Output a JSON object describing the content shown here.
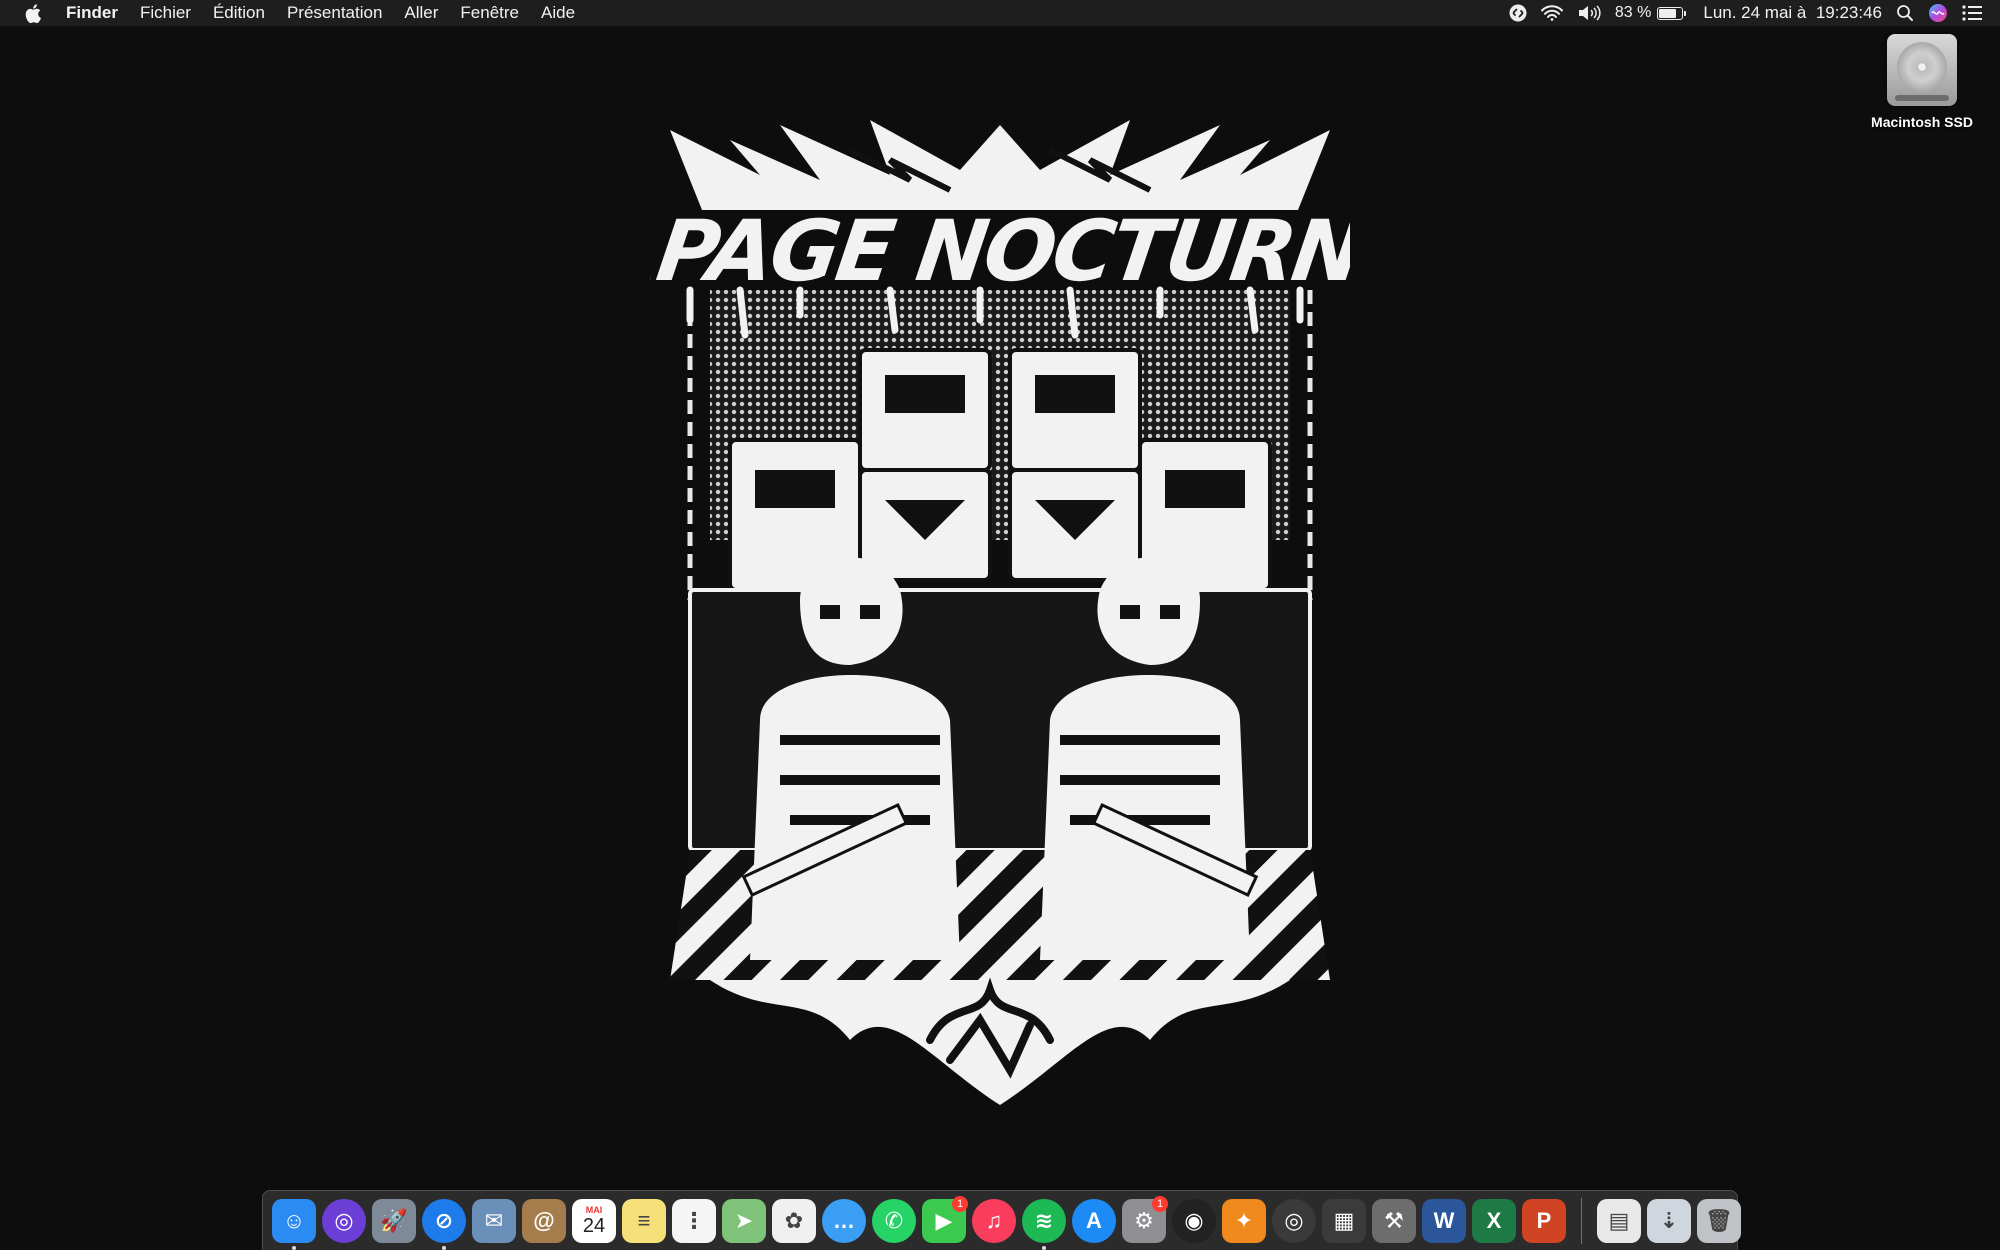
{
  "menubar": {
    "app_name": "Finder",
    "menus": [
      "Fichier",
      "Édition",
      "Présentation",
      "Aller",
      "Fenêtre",
      "Aide"
    ],
    "status": {
      "icons": [
        "shazam-icon",
        "wifi-icon",
        "volume-icon"
      ],
      "battery_percent_label": "83 %",
      "battery_level": 0.83,
      "clock": "Lun. 24 mai à  19:23:46",
      "right_icons": [
        "spotlight-icon",
        "siri-icon",
        "notification-center-icon"
      ]
    }
  },
  "desktop": {
    "icons": [
      {
        "label": "Macintosh SSD",
        "icon": "hard-drive-icon"
      }
    ]
  },
  "wallpaper": {
    "title": "TAPAGE NOCTURNE",
    "signature": "artist tag"
  },
  "dock": {
    "apps": [
      {
        "name": "Finder",
        "icon": "finder-icon",
        "color": "#2a8bf2",
        "glyph": "☺",
        "running": true
      },
      {
        "name": "Siri",
        "icon": "siri-icon",
        "color": "#6b3fd6",
        "glyph": "◎"
      },
      {
        "name": "Launchpad",
        "icon": "launchpad-icon",
        "color": "#7f8a99",
        "glyph": "🚀"
      },
      {
        "name": "Safari",
        "icon": "safari-icon",
        "color": "#1e7bea",
        "glyph": "⊘",
        "running": true
      },
      {
        "name": "Aperçu",
        "icon": "preview-icon",
        "color": "#6a8fb8",
        "glyph": "✉"
      },
      {
        "name": "Contacts",
        "icon": "contacts-icon",
        "color": "#a57c4b",
        "glyph": "@"
      },
      {
        "name": "Calendrier",
        "icon": "calendar-icon",
        "color": "#ffffff",
        "glyph": "24",
        "month": "MAI"
      },
      {
        "name": "Notes",
        "icon": "notes-icon",
        "color": "#f6e07a",
        "glyph": "≡"
      },
      {
        "name": "Rappels",
        "icon": "reminders-icon",
        "color": "#f5f5f5",
        "glyph": "⋮"
      },
      {
        "name": "Plans",
        "icon": "maps-icon",
        "color": "#7fc27a",
        "glyph": "➤"
      },
      {
        "name": "Photos",
        "icon": "photos-icon",
        "color": "#f0f0f0",
        "glyph": "✿"
      },
      {
        "name": "Messages",
        "icon": "messages-icon",
        "color": "#3a9ef5",
        "glyph": "…"
      },
      {
        "name": "WhatsApp",
        "icon": "whatsapp-icon",
        "color": "#25d366",
        "glyph": "✆"
      },
      {
        "name": "FaceTime",
        "icon": "facetime-icon",
        "color": "#3cc94f",
        "glyph": "▶",
        "badge": "1"
      },
      {
        "name": "Musique",
        "icon": "music-icon",
        "color": "#fa3d5d",
        "glyph": "♫"
      },
      {
        "name": "Spotify",
        "icon": "spotify-icon",
        "color": "#1db954",
        "glyph": "≋",
        "running": true
      },
      {
        "name": "App Store",
        "icon": "app-store-icon",
        "color": "#1c8bf5",
        "glyph": "A"
      },
      {
        "name": "Préférences Système",
        "icon": "system-preferences-icon",
        "color": "#8e8e93",
        "glyph": "⚙",
        "badge": "1"
      },
      {
        "name": "Scrobbler",
        "icon": "record-player-icon",
        "color": "#222222",
        "glyph": "◉"
      },
      {
        "name": "FL Studio",
        "icon": "fl-studio-icon",
        "color": "#f08a1c",
        "glyph": "✦"
      },
      {
        "name": "Vinyl",
        "icon": "vinyl-icon",
        "color": "#3a3a3a",
        "glyph": "◎"
      },
      {
        "name": "Final Cut Pro",
        "icon": "final-cut-icon",
        "color": "#3b3b3b",
        "glyph": "▦"
      },
      {
        "name": "Compressor",
        "icon": "compressor-icon",
        "color": "#6d6d6d",
        "glyph": "⚒"
      },
      {
        "name": "Word",
        "icon": "word-icon",
        "color": "#2b579a",
        "glyph": "W"
      },
      {
        "name": "Excel",
        "icon": "excel-icon",
        "color": "#1d7a45",
        "glyph": "X"
      },
      {
        "name": "PowerPoint",
        "icon": "powerpoint-icon",
        "color": "#d04423",
        "glyph": "P"
      }
    ],
    "others": [
      {
        "name": "Documents",
        "icon": "document-icon",
        "color": "#e8e8e8",
        "glyph": "▤"
      },
      {
        "name": "Téléchargements",
        "icon": "downloads-icon",
        "color": "#cfd6de",
        "glyph": "⇣"
      },
      {
        "name": "Corbeille",
        "icon": "trash-icon",
        "color": "#bfc3c7",
        "glyph": "🗑"
      }
    ]
  }
}
